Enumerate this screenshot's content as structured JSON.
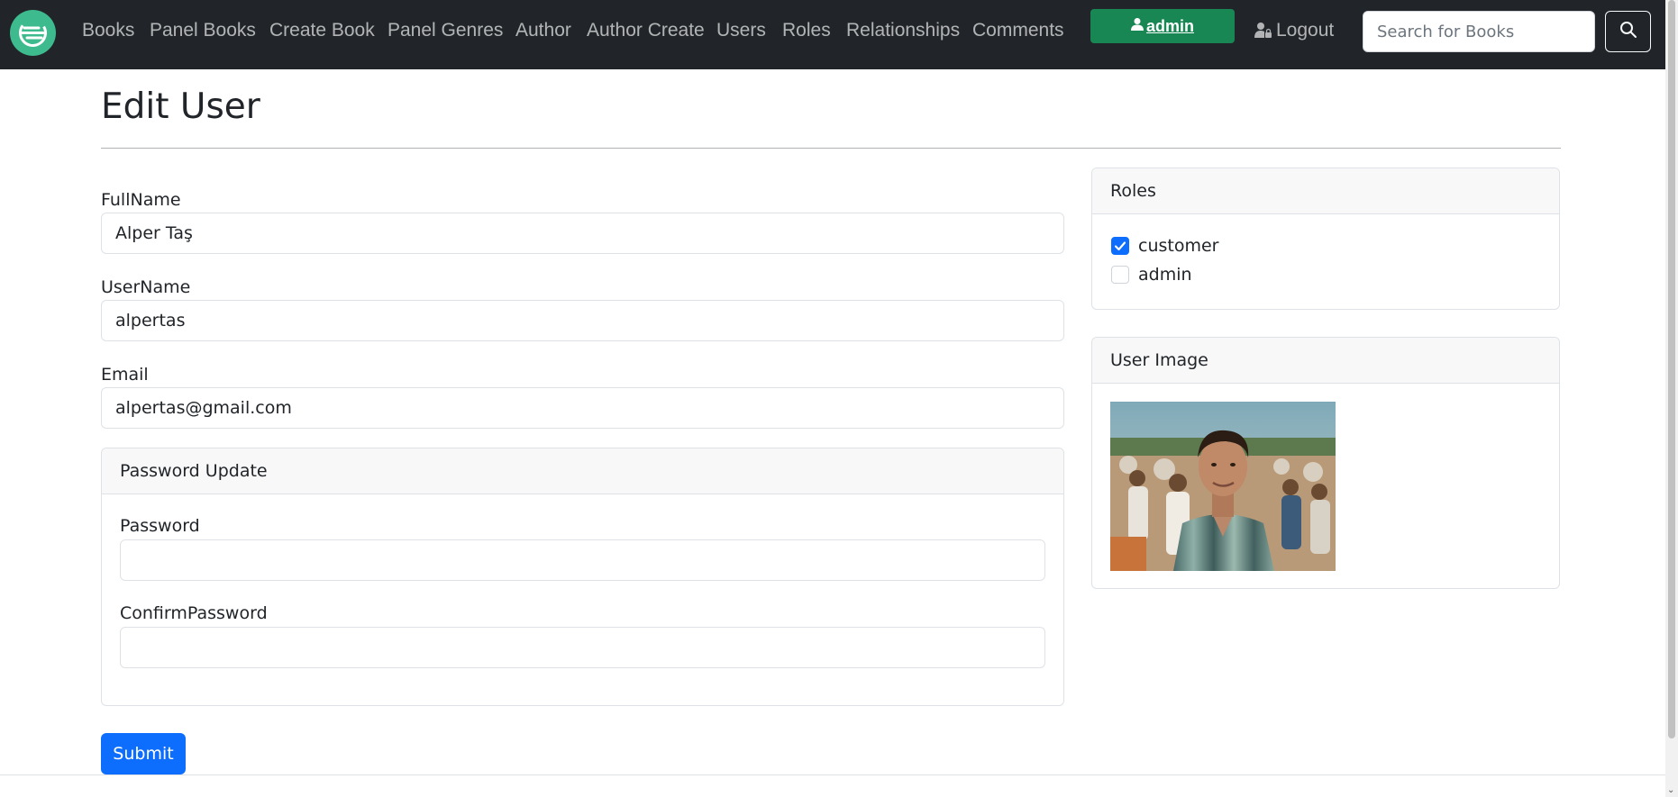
{
  "nav": {
    "links": [
      "Books",
      "Panel Books",
      "Create Book",
      "Panel Genres",
      "Author",
      "Author Create",
      "Users",
      "Roles",
      "Relationships",
      "Comments"
    ],
    "admin_label": "admin",
    "logout_label": "Logout",
    "search_placeholder": "Search for Books"
  },
  "page": {
    "title": "Edit User"
  },
  "form": {
    "fullname_label": "FullName",
    "fullname_value": "Alper Taş",
    "username_label": "UserName",
    "username_value": "alpertas",
    "email_label": "Email",
    "email_value": "alpertas@gmail.com",
    "password_section_title": "Password Update",
    "password_label": "Password",
    "password_value": "",
    "confirm_label": "ConfirmPassword",
    "confirm_value": "",
    "submit_label": "Submit"
  },
  "roles": {
    "title": "Roles",
    "items": [
      {
        "name": "customer",
        "checked": true
      },
      {
        "name": "admin",
        "checked": false
      }
    ]
  },
  "user_image": {
    "title": "User Image"
  },
  "colors": {
    "navbar": "#212529",
    "admin_button": "#198754",
    "primary": "#0d6efd",
    "logo": "#3dbb8e"
  }
}
